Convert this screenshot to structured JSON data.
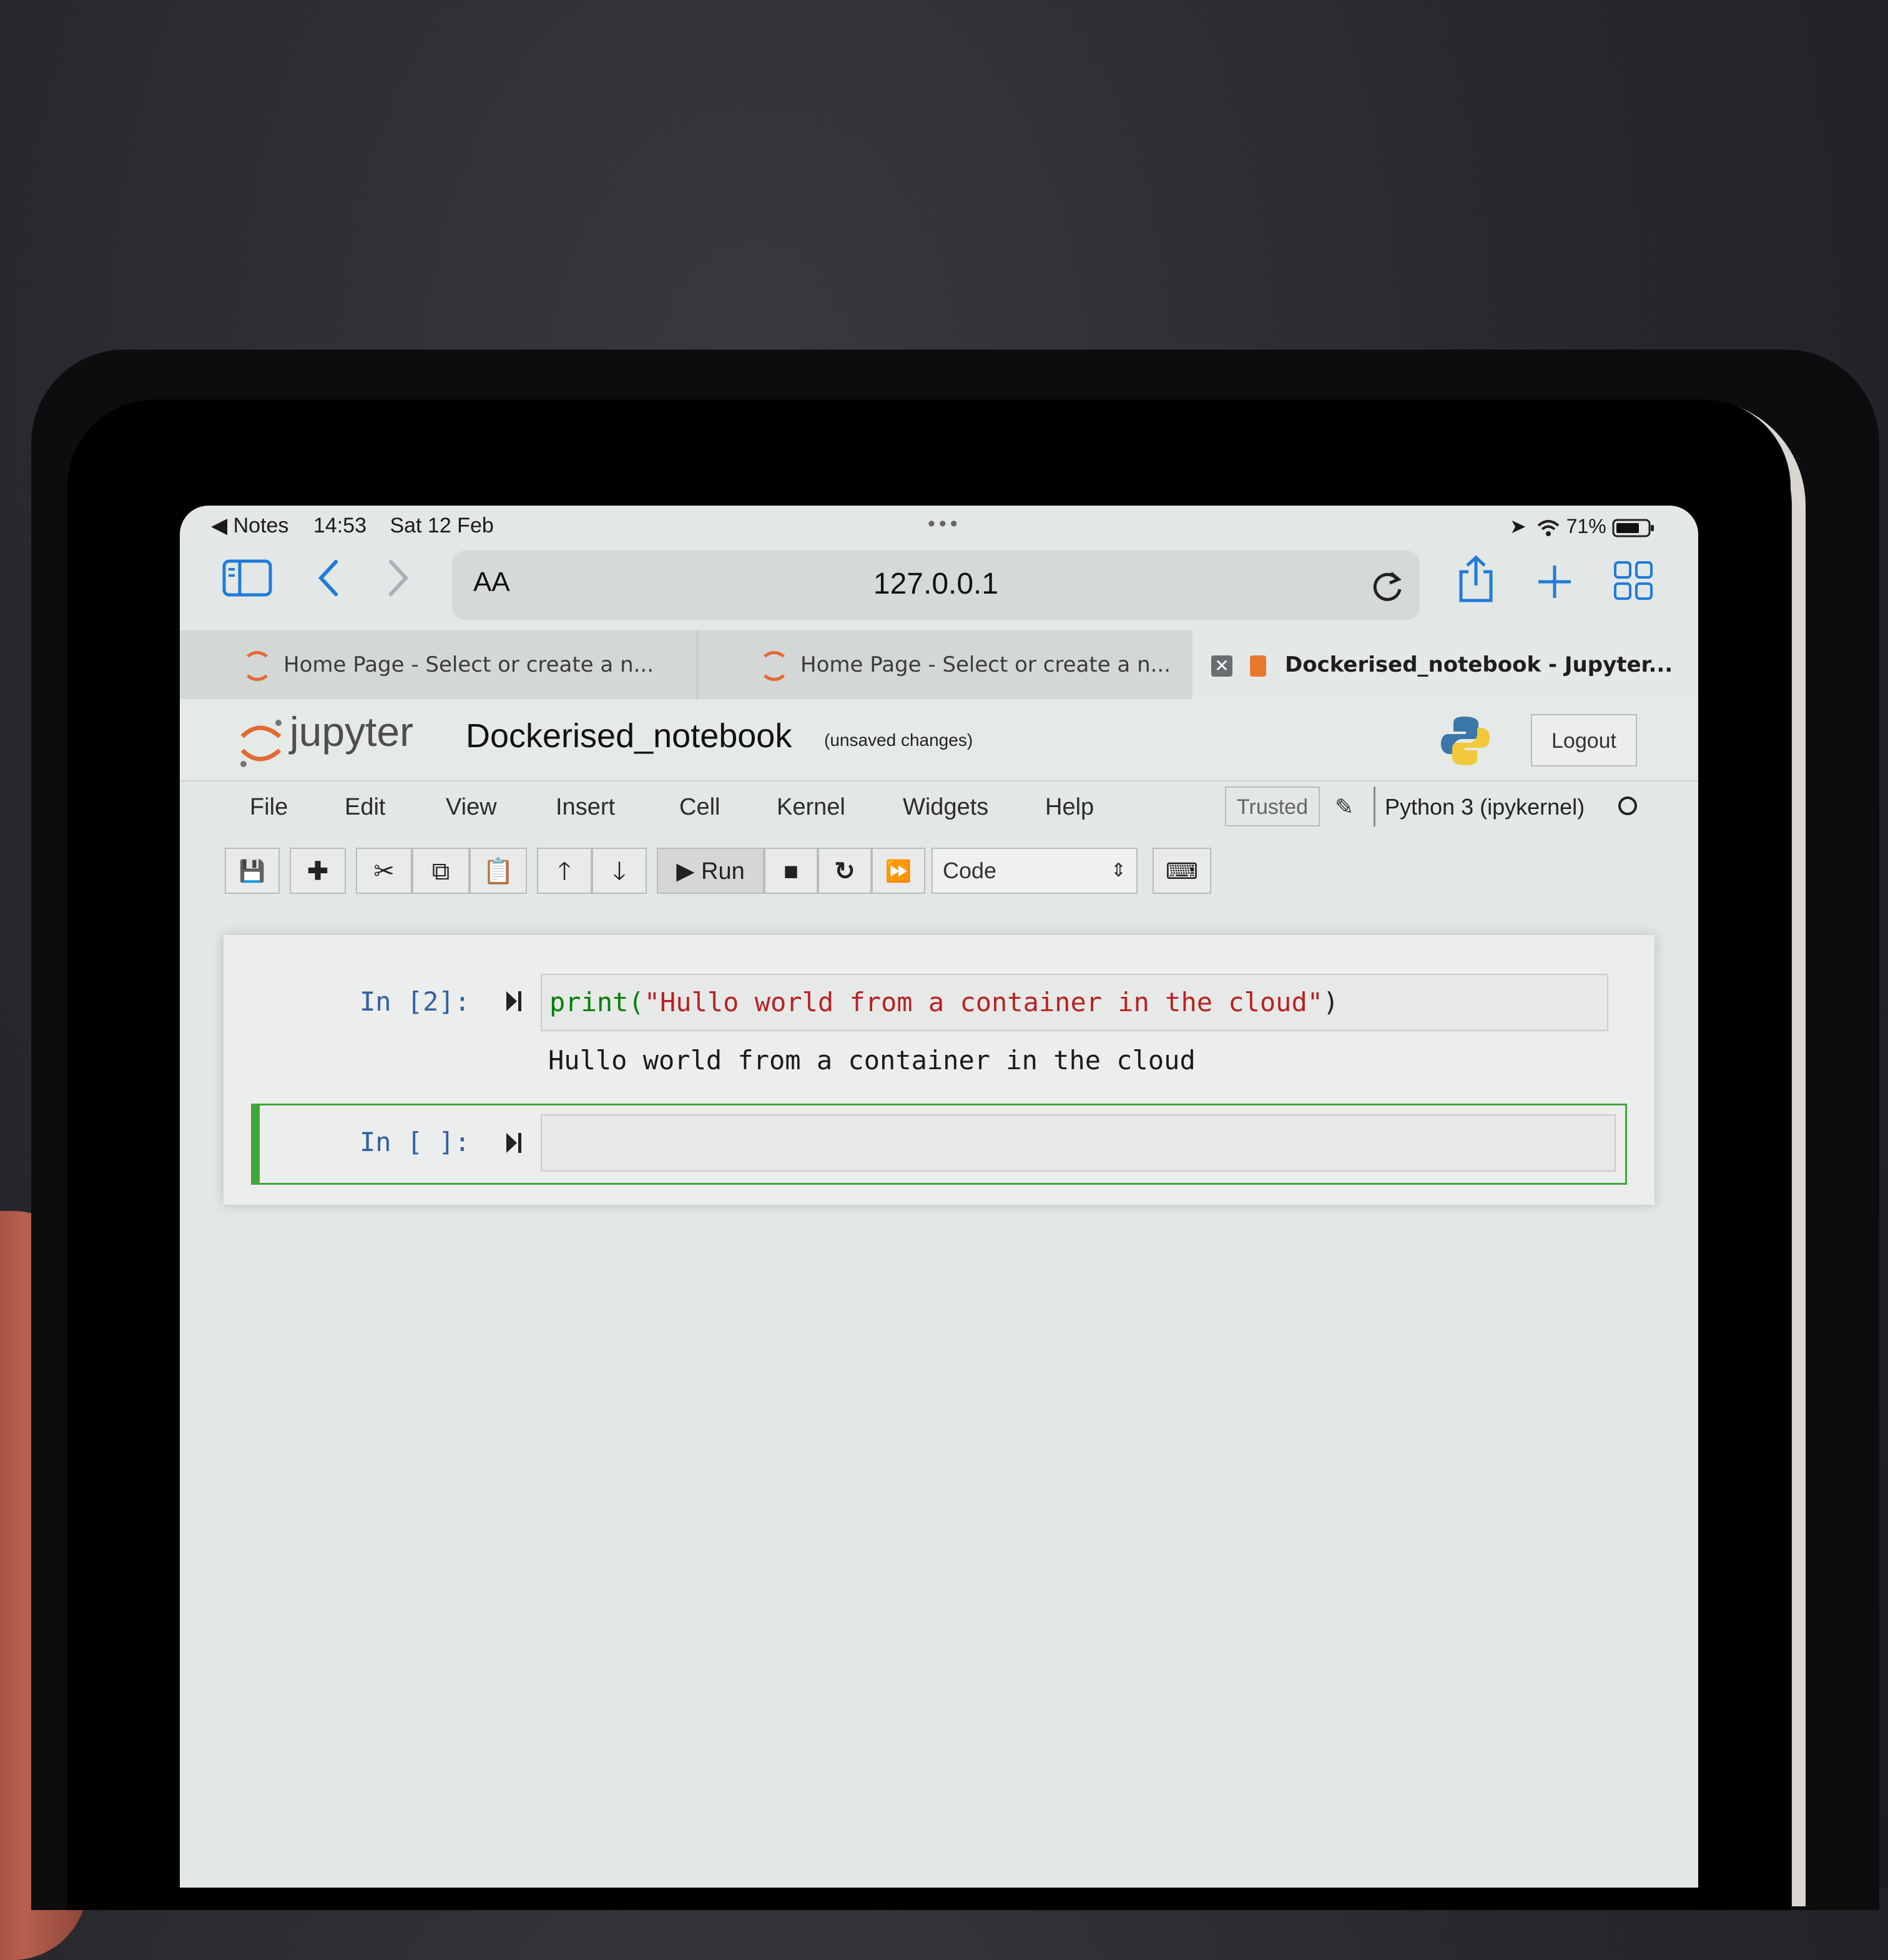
{
  "status_bar": {
    "back_app": "Notes",
    "time": "14:53",
    "date": "Sat 12 Feb",
    "more": "•••",
    "battery": "71%"
  },
  "browser": {
    "reader_label": "AA",
    "url": "127.0.0.1",
    "tabs": [
      {
        "title": "Home Page - Select or create a n..."
      },
      {
        "title": "Home Page - Select or create a n..."
      },
      {
        "title": "Dockerised_notebook - Jupyter..."
      }
    ]
  },
  "notebook": {
    "logo_text": "jupyter",
    "name": "Dockerised_notebook",
    "save_status": "(unsaved changes)",
    "logout_label": "Logout",
    "menus": [
      "File",
      "Edit",
      "View",
      "Insert",
      "Cell",
      "Kernel",
      "Widgets",
      "Help"
    ],
    "trusted_label": "Trusted",
    "kernel_name": "Python 3 (ipykernel)",
    "run_label": "Run",
    "cell_type": "Code",
    "cells": [
      {
        "prompt": "In [2]:",
        "code_func": "print(",
        "code_string": "\"Hullo world from a container in the cloud\"",
        "code_close": ")",
        "output": "Hullo world from a container in the cloud"
      },
      {
        "prompt": "In [ ]:",
        "code": ""
      }
    ]
  },
  "colors": {
    "jupyter_orange": "#e46a32",
    "safari_blue": "#1f7bd8",
    "prompt_blue": "#30609f",
    "string_red": "#ba2121",
    "builtin_green": "#008000",
    "selected_cell_green": "#42a53a"
  }
}
